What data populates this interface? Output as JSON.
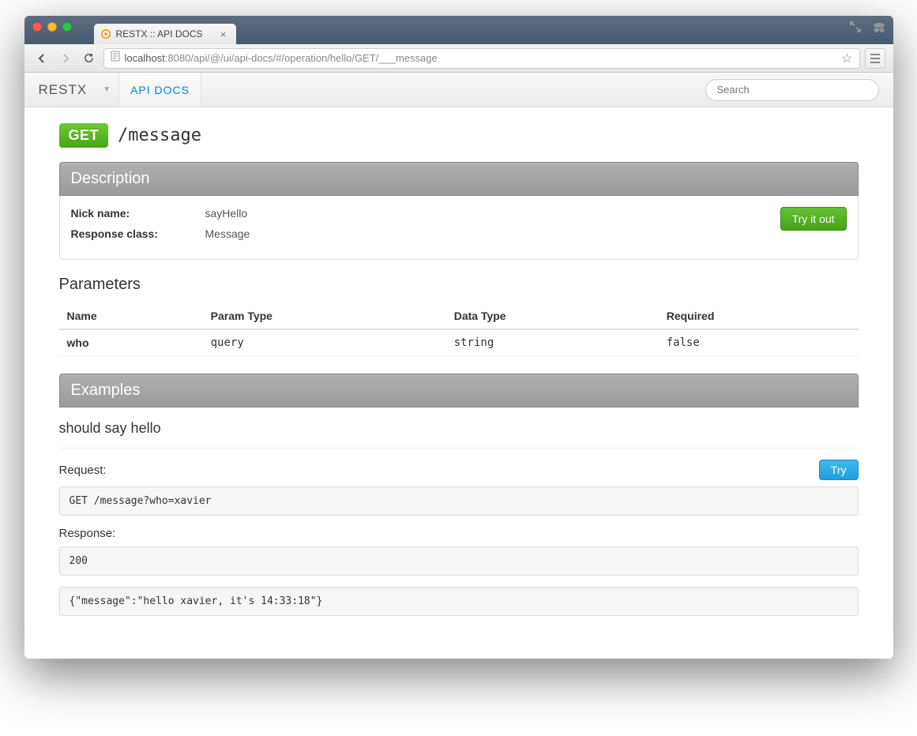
{
  "browser": {
    "tab_title": "RESTX :: API DOCS",
    "url_host": "localhost",
    "url_rest": ":8080/api/@/ui/api-docs/#/operation/hello/GET/___message"
  },
  "navbar": {
    "brand": "RESTX",
    "link": "API DOCS",
    "search_placeholder": "Search"
  },
  "endpoint": {
    "method": "GET",
    "path": "/message"
  },
  "sections": {
    "description": "Description",
    "examples": "Examples"
  },
  "description": {
    "nickname_label": "Nick name:",
    "nickname_value": "sayHello",
    "response_class_label": "Response class:",
    "response_class_value": "Message",
    "try_label": "Try it out"
  },
  "parameters": {
    "heading": "Parameters",
    "headers": {
      "name": "Name",
      "param_type": "Param Type",
      "data_type": "Data Type",
      "required": "Required"
    },
    "rows": [
      {
        "name": "who",
        "param_type": "query",
        "data_type": "string",
        "required": "false"
      }
    ]
  },
  "example": {
    "title": "should say hello",
    "request_label": "Request:",
    "try_label": "Try",
    "request_body": "GET /message?who=xavier",
    "response_label": "Response:",
    "response_status": "200",
    "response_body": "{\"message\":\"hello xavier, it's 14:33:18\"}"
  }
}
